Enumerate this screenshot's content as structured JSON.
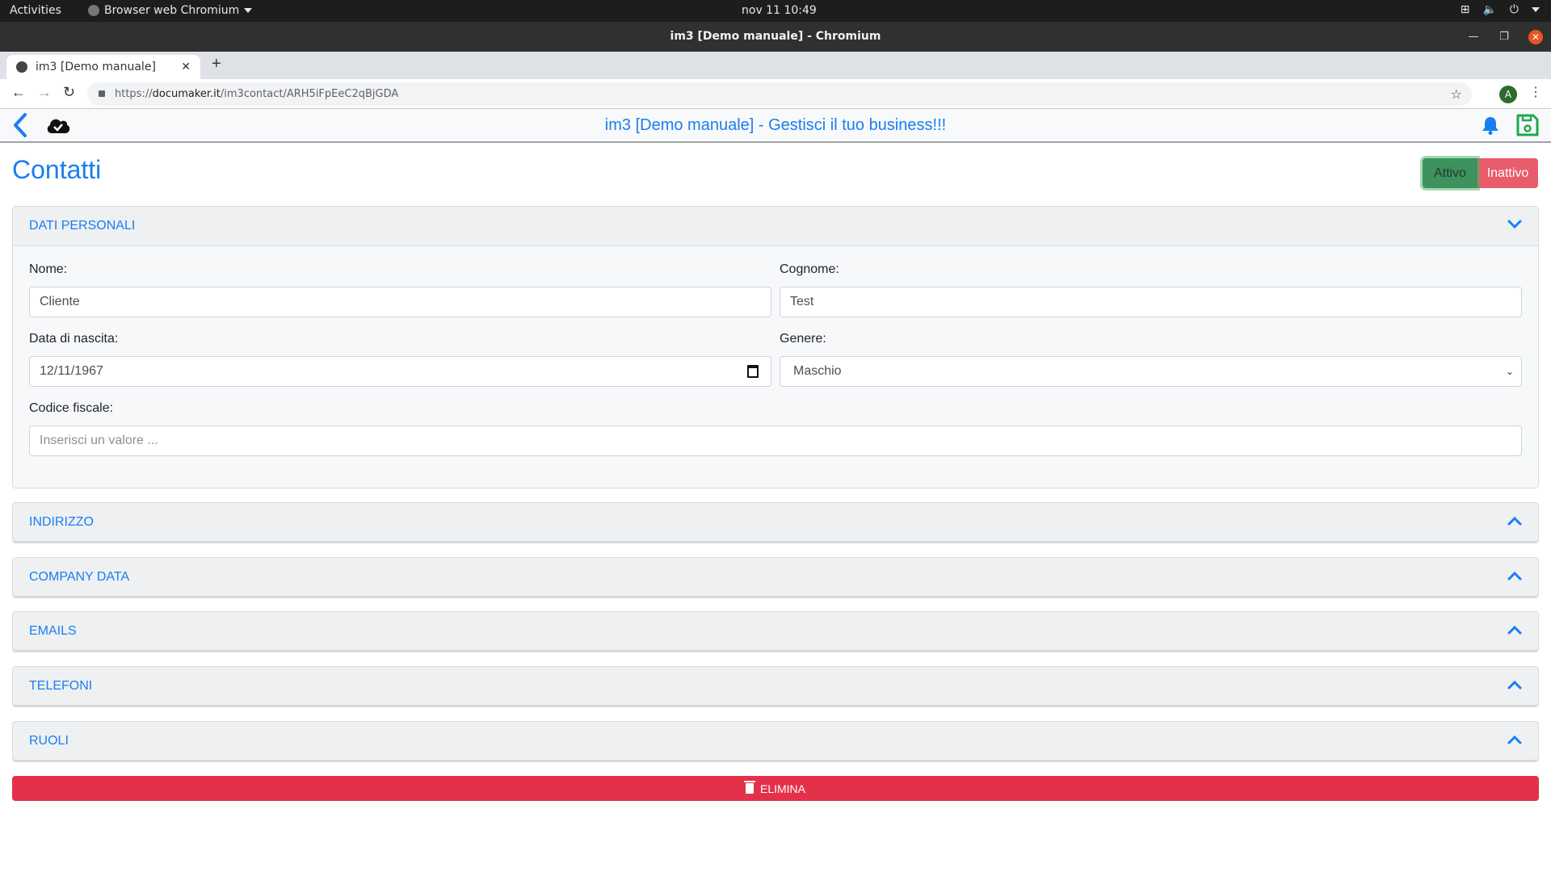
{
  "os": {
    "activities": "Activities",
    "app_menu": "Browser web Chromium",
    "clock": "nov 11  10:49"
  },
  "window": {
    "title": "im3 [Demo manuale] - Chromium"
  },
  "browser": {
    "tab_title": "im3 [Demo manuale]",
    "url_scheme": "https://",
    "url_domain": "documaker.it",
    "url_path": "/im3contact/ARH5iFpEeC2qBjGDA",
    "profile_initial": "A"
  },
  "app": {
    "header_title": "im3 [Demo manuale] - Gestisci il tuo business!!!",
    "page_title": "Contatti",
    "status": {
      "active_label": "Attivo",
      "inactive_label": "Inattivo",
      "selected": "Attivo"
    },
    "sections": [
      {
        "title": "DATI PERSONALI",
        "expanded": true
      },
      {
        "title": "INDIRIZZO",
        "expanded": false
      },
      {
        "title": "COMPANY DATA",
        "expanded": false
      },
      {
        "title": "EMAILS",
        "expanded": false
      },
      {
        "title": "TELEFONI",
        "expanded": false
      },
      {
        "title": "RUOLI",
        "expanded": false
      }
    ],
    "form": {
      "nome_label": "Nome:",
      "nome_value": "Cliente",
      "cognome_label": "Cognome:",
      "cognome_value": "Test",
      "data_label": "Data di nascita:",
      "data_value": "12/11/1967",
      "genere_label": "Genere:",
      "genere_value": "Maschio",
      "codice_label": "Codice fiscale:",
      "codice_value": "",
      "codice_placeholder": "Inserisci un valore ..."
    },
    "delete_label": "ELIMINA"
  },
  "colors": {
    "accent": "#1a7ef0",
    "active": "#3d9260",
    "inactive": "#e95c6c",
    "danger": "#e3314a",
    "save": "#1fa84f"
  }
}
